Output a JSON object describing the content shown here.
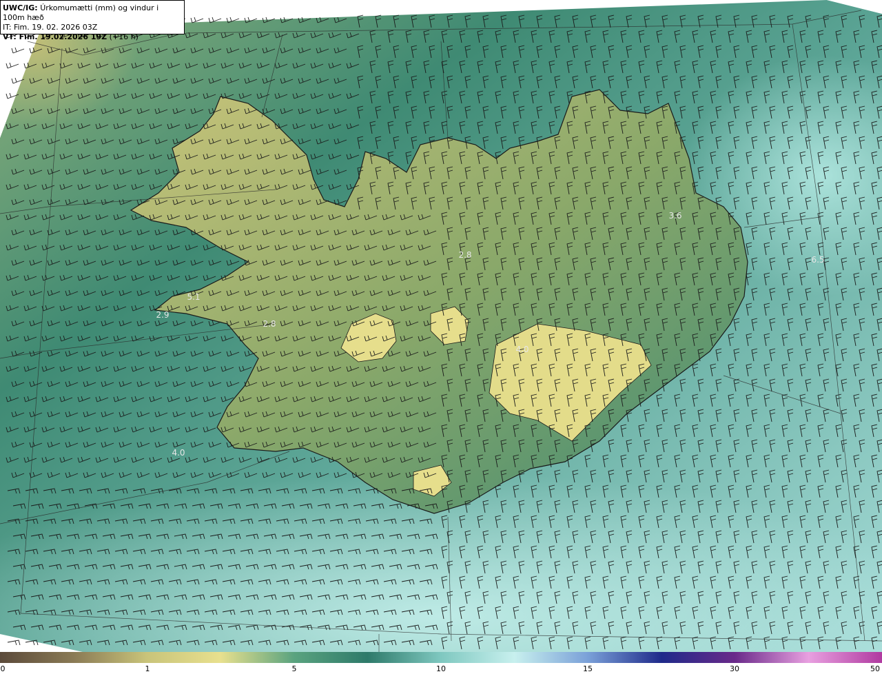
{
  "title": {
    "product": "UWC/IG:",
    "description": "Úrkomumætti (mm) og vindur i 100m hæð",
    "init_time": "IT: Fim. 19. 02. 2026 03Z",
    "valid_prefix": "VT: Fim. 19.02.2026 19Z",
    "valid_suffix": "(+16 h)"
  },
  "map_labels": [
    {
      "id": "label-1",
      "text": "3.6"
    },
    {
      "id": "label-2",
      "text": "2.8"
    },
    {
      "id": "label-3",
      "text": "6.5"
    },
    {
      "id": "label-4",
      "text": "5.1"
    },
    {
      "id": "label-5",
      "text": "2.9"
    },
    {
      "id": "label-6",
      "text": "2.8"
    },
    {
      "id": "label-7",
      "text": "4.0"
    },
    {
      "id": "label-8",
      "text": "4.0"
    }
  ],
  "colorbar": {
    "ticks": [
      "0",
      "1",
      "5",
      "10",
      "15",
      "30",
      "50"
    ],
    "colors": [
      "#5b4a3a",
      "#8a7a55",
      "#c9c47a",
      "#e8e08e",
      "#5aa37f",
      "#2e7a6a",
      "#7fc8c0",
      "#c8f0ee",
      "#7aa0d8",
      "#1f2a8a",
      "#6a2a8a",
      "#e8a0e0",
      "#b03aa0"
    ]
  },
  "colors": {
    "sea_teal": "#5fa89a",
    "sea_light": "#9fdcd6",
    "land_yellow": "#c9c47a",
    "land_green": "#3f8a73"
  }
}
